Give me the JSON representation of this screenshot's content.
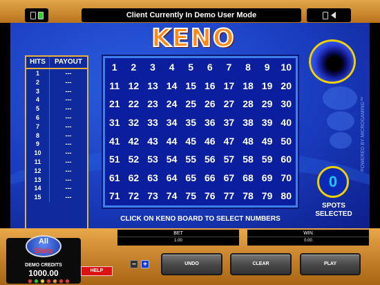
{
  "status_bar": {
    "message": "Client Currently In Demo User Mode",
    "left_icons": [
      "window-icon",
      "fullscreen-icon"
    ],
    "right_icons": [
      "settings-icon",
      "speaker-icon"
    ]
  },
  "game": {
    "title": "KENO",
    "instruction": "CLICK ON KENO BOARD TO SELECT NUMBERS",
    "powered_by": "POWERED BY MICROGAMING™"
  },
  "paytable": {
    "headers": [
      "HITS",
      "PAYOUT"
    ],
    "rows": [
      {
        "hits": "1",
        "payout": "---"
      },
      {
        "hits": "2",
        "payout": "---"
      },
      {
        "hits": "3",
        "payout": "---"
      },
      {
        "hits": "4",
        "payout": "---"
      },
      {
        "hits": "5",
        "payout": "---"
      },
      {
        "hits": "6",
        "payout": "---"
      },
      {
        "hits": "7",
        "payout": "---"
      },
      {
        "hits": "8",
        "payout": "---"
      },
      {
        "hits": "9",
        "payout": "---"
      },
      {
        "hits": "10",
        "payout": "---"
      },
      {
        "hits": "11",
        "payout": "---"
      },
      {
        "hits": "12",
        "payout": "---"
      },
      {
        "hits": "13",
        "payout": "---"
      },
      {
        "hits": "14",
        "payout": "---"
      },
      {
        "hits": "15",
        "payout": "---"
      }
    ]
  },
  "board": {
    "numbers": [
      "1",
      "2",
      "3",
      "4",
      "5",
      "6",
      "7",
      "8",
      "9",
      "10",
      "11",
      "12",
      "13",
      "14",
      "15",
      "16",
      "17",
      "18",
      "19",
      "20",
      "21",
      "22",
      "23",
      "24",
      "25",
      "26",
      "27",
      "28",
      "29",
      "30",
      "31",
      "32",
      "33",
      "34",
      "35",
      "36",
      "37",
      "38",
      "39",
      "40",
      "41",
      "42",
      "43",
      "44",
      "45",
      "46",
      "47",
      "48",
      "49",
      "50",
      "51",
      "52",
      "53",
      "54",
      "55",
      "56",
      "57",
      "58",
      "59",
      "60",
      "61",
      "62",
      "63",
      "64",
      "65",
      "66",
      "67",
      "68",
      "69",
      "70",
      "71",
      "72",
      "73",
      "74",
      "75",
      "76",
      "77",
      "78",
      "79",
      "80"
    ]
  },
  "spots": {
    "count": "0",
    "label_line1": "SPOTS",
    "label_line2": "SELECTED"
  },
  "console": {
    "logo_line1": "All",
    "logo_line2": "Slots",
    "demo_label": "DEMO CREDITS",
    "credits": "1000.00",
    "help_label": "HELP",
    "minus_label": "−",
    "plus_label": "+",
    "bet_label": "BET",
    "bet_value": "1.00",
    "win_label": "WIN",
    "win_value": "0.00",
    "undo_label": "UNDO",
    "clear_label": "CLEAR",
    "play_label": "PLAY"
  },
  "colors": {
    "chips": [
      "#e33",
      "#2c2",
      "#fc2",
      "#e33",
      "#e93",
      "#e33",
      "#e33"
    ]
  }
}
